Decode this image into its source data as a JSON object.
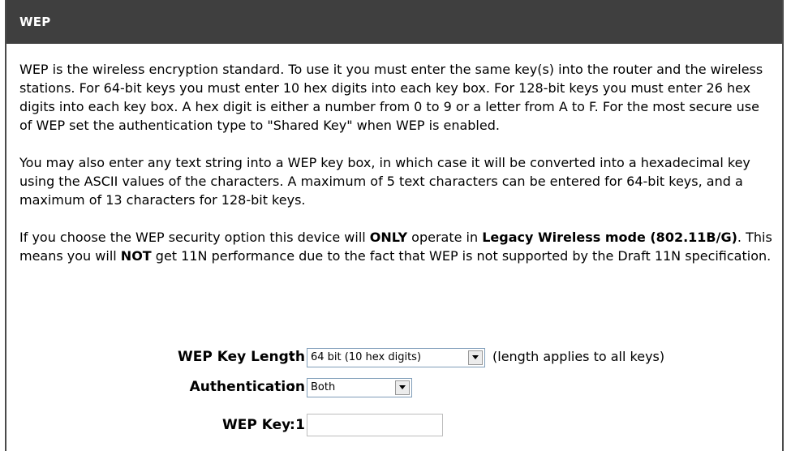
{
  "section": {
    "title": "WEP"
  },
  "paragraphs": {
    "p1": "WEP is the wireless encryption standard. To use it you must enter the same key(s) into the router and the wireless stations. For 64-bit keys you must enter 10 hex digits into each key box. For 128-bit keys you must enter 26 hex digits into each key box. A hex digit is either a number from 0 to 9 or a letter from A to F. For the most secure use of WEP set the authentication type to \"Shared Key\" when WEP is enabled.",
    "p2": "You may also enter any text string into a WEP key box, in which case it will be converted into a hexadecimal key using the ASCII values of the characters. A maximum of 5 text characters can be entered for 64-bit keys, and a maximum of 13 characters for 128-bit keys.",
    "p3": {
      "t1": "If you choose the WEP security option this device will ",
      "b1": "ONLY",
      "t2": " operate in ",
      "b2": "Legacy Wireless mode (802.11B/G)",
      "t3": ". This means you will ",
      "b3": "NOT",
      "t4": " get 11N performance due to the fact that WEP is not supported by the Draft 11N specification."
    }
  },
  "form": {
    "key_length": {
      "label": "WEP Key Length",
      "colon": ":",
      "value": "64 bit (10 hex digits)",
      "note": "(length applies to all keys)"
    },
    "authentication": {
      "label": "Authentication",
      "colon": ":",
      "value": "Both"
    },
    "key1": {
      "label": "WEP Key 1",
      "colon": ":",
      "value": ""
    }
  },
  "colors": {
    "header_bg": "#3f3f3f",
    "header_text": "#ffffff",
    "border": "#4a4a4a"
  }
}
